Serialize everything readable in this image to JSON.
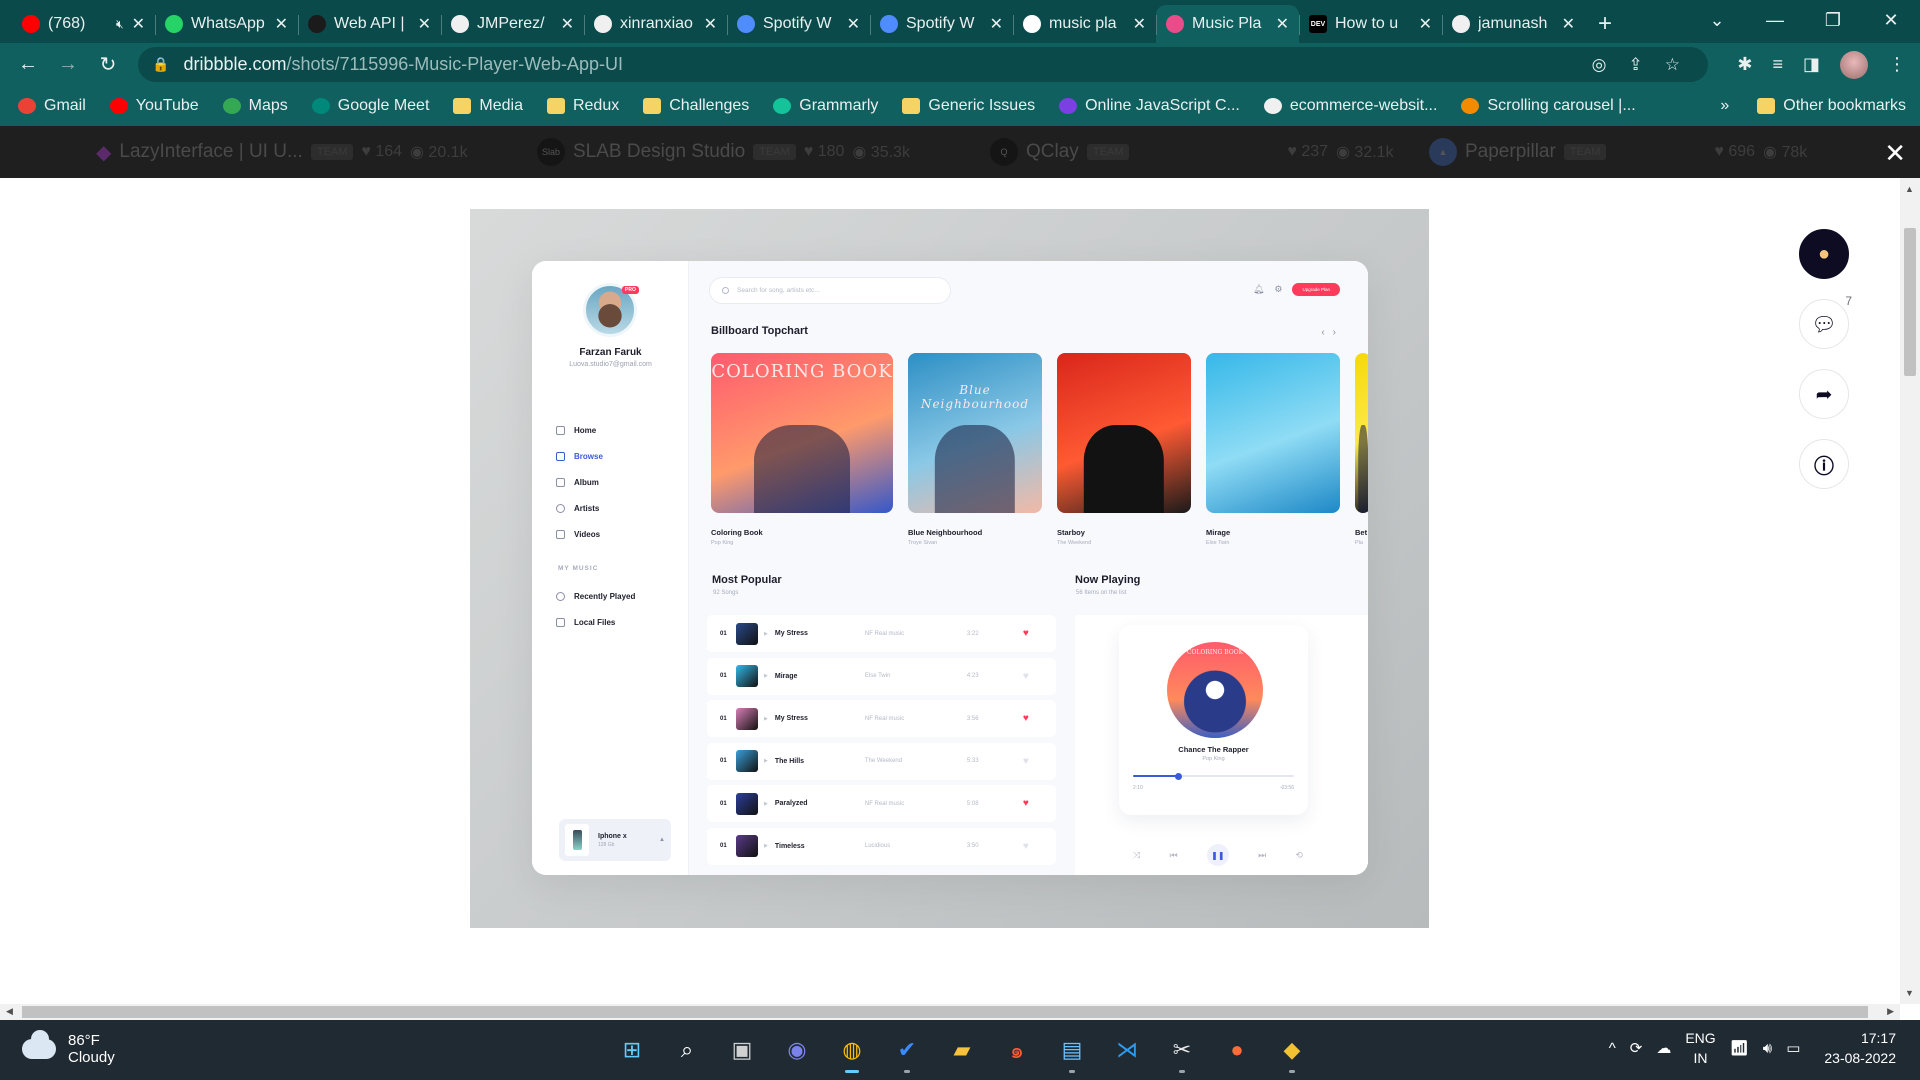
{
  "browser": {
    "tabs": [
      {
        "title": "(768)",
        "icon": "youtube-icon",
        "color": "#ff0000",
        "muted": true
      },
      {
        "title": "WhatsApp",
        "icon": "whatsapp-icon",
        "color": "#25d366"
      },
      {
        "title": "Web API |",
        "icon": "spotify-icon",
        "color": "#1b1b1b"
      },
      {
        "title": "JMPerez/",
        "icon": "github-icon",
        "color": "#f0f0f0"
      },
      {
        "title": "xinranxiao",
        "icon": "github-icon",
        "color": "#f0f0f0"
      },
      {
        "title": "Spotify W",
        "icon": "cloud-icon",
        "color": "#4f8cff"
      },
      {
        "title": "Spotify W",
        "icon": "cloud-icon",
        "color": "#4f8cff"
      },
      {
        "title": "music pla",
        "icon": "google-icon",
        "color": "#ffffff"
      },
      {
        "title": "Music Pla",
        "icon": "dribbble-icon",
        "color": "#ea4c89",
        "active": true
      },
      {
        "title": "How to u",
        "icon": "dev-icon",
        "color": "#000000"
      },
      {
        "title": "jamunash",
        "icon": "github-icon",
        "color": "#f0f0f0"
      }
    ],
    "url_host": "dribbble.com",
    "url_path": "/shots/7115996-Music-Player-Web-App-UI",
    "bookmarks": [
      {
        "label": "Gmail",
        "icon": "gmail-icon",
        "color": "#ea4335"
      },
      {
        "label": "YouTube",
        "icon": "youtube-icon",
        "color": "#ff0000"
      },
      {
        "label": "Maps",
        "icon": "maps-icon",
        "color": "#34a853"
      },
      {
        "label": "Google Meet",
        "icon": "meet-icon",
        "color": "#00897b"
      },
      {
        "label": "Media",
        "icon": "folder-icon",
        "color": "#f6d365"
      },
      {
        "label": "Redux",
        "icon": "folder-icon",
        "color": "#f6d365"
      },
      {
        "label": "Challenges",
        "icon": "folder-icon",
        "color": "#f6d365"
      },
      {
        "label": "Grammarly",
        "icon": "grammarly-icon",
        "color": "#15c39a"
      },
      {
        "label": "Generic Issues",
        "icon": "folder-icon",
        "color": "#f6d365"
      },
      {
        "label": "Online JavaScript C...",
        "icon": "js-icon",
        "color": "#7b3fe4"
      },
      {
        "label": "ecommerce-websit...",
        "icon": "github-icon",
        "color": "#f0f0f0"
      },
      {
        "label": "Scrolling carousel |...",
        "icon": "bookmark-icon",
        "color": "#f28b00"
      }
    ],
    "more_label": "»",
    "other_bookmarks": "Other bookmarks"
  },
  "dribbble": {
    "strip": [
      {
        "name": "LazyInterface | UI U...",
        "team": "TEAM",
        "likes": "164",
        "views": "20.1k"
      },
      {
        "name": "SLAB Design Studio",
        "team": "TEAM",
        "likes": "180",
        "views": "35.3k"
      },
      {
        "name": "QClay",
        "team": "TEAM",
        "likes": "237",
        "views": "32.1k"
      },
      {
        "name": "Paperpillar",
        "team": "TEAM",
        "likes": "696",
        "views": "78k"
      }
    ],
    "comments_count": "7"
  },
  "app": {
    "user_name": "Farzan Faruk",
    "user_email": "Luova.studio7@gmail.com",
    "pro_badge": "PRO",
    "nav": [
      "Home",
      "Browse",
      "Album",
      "Artists",
      "Videos"
    ],
    "my_music_title": "MY MUSIC",
    "my_music": [
      "Recently Played",
      "Local Files"
    ],
    "device_name": "Iphone x",
    "device_sub": "128 Gb",
    "search_placeholder": "Search for song, artists etc...",
    "upgrade_label": "Upgrade Plan",
    "billboard_title": "Billboard Topchart",
    "albums": [
      {
        "title": "Coloring Book",
        "artist": "Pop King",
        "cover_text": "COLORING BOOK",
        "colors": [
          "#ff5a6e",
          "#ff9a6b",
          "#3558c9"
        ]
      },
      {
        "title": "Blue Neighbourhood",
        "artist": "Troye Sivan",
        "cover_text": "Blue Neighbourhood",
        "colors": [
          "#2d8fc4",
          "#8ac8e6",
          "#f2b9a6"
        ]
      },
      {
        "title": "Starboy",
        "artist": "The Weekend",
        "cover_text": "",
        "colors": [
          "#d9261c",
          "#ff5a33",
          "#1a1a1a"
        ]
      },
      {
        "title": "Mirage",
        "artist": "Else Twin",
        "cover_text": "",
        "colors": [
          "#35b8e8",
          "#8fdcf5",
          "#1d88c6"
        ]
      },
      {
        "title": "Bet",
        "artist": "Pla",
        "cover_text": "",
        "colors": [
          "#f5d90a",
          "#ffe94a",
          "#222222"
        ]
      }
    ],
    "popular_title": "Most Popular",
    "popular_sub": "92 Songs",
    "tracks": [
      {
        "num": "01",
        "name": "My Stress",
        "artist": "NF Real music",
        "duration": "3:22",
        "liked": true,
        "color": "#2a4a8a"
      },
      {
        "num": "01",
        "name": "Mirage",
        "artist": "Else Twin",
        "duration": "4:23",
        "liked": false,
        "color": "#35b8e8"
      },
      {
        "num": "01",
        "name": "My Stress",
        "artist": "NF Real music",
        "duration": "3:56",
        "liked": true,
        "color": "#d97fb6"
      },
      {
        "num": "01",
        "name": "The Hills",
        "artist": "The Weekend",
        "duration": "5:33",
        "liked": false,
        "color": "#3aa0d8"
      },
      {
        "num": "01",
        "name": "Paralyzed",
        "artist": "NF Real music",
        "duration": "5:08",
        "liked": true,
        "color": "#2c3f9a"
      },
      {
        "num": "01",
        "name": "Timeless",
        "artist": "Lucidious",
        "duration": "3:50",
        "liked": false,
        "color": "#5a3a8a"
      }
    ],
    "now_title": "Now Playing",
    "now_sub": "56 Items on the list",
    "now_song": "Chance The Rapper",
    "now_artist": "Pop King",
    "now_disc_text": "COLORING BOOK",
    "now_progress": 0.28,
    "time_current": "2:10",
    "time_total": "-03:56",
    "accent": "#3a5bd9",
    "heart_color": "#ff3b5c"
  },
  "taskbar": {
    "temperature": "86°F",
    "condition": "Cloudy",
    "lang_1": "ENG",
    "lang_2": "IN",
    "time": "17:17",
    "date": "23-08-2022",
    "apps": [
      "start-icon",
      "search-icon",
      "task-view-icon",
      "teams-icon",
      "chrome-icon",
      "todo-icon",
      "file-explorer-icon",
      "snail-icon",
      "notepad-icon",
      "vscode-icon",
      "snipping-icon",
      "postman-icon",
      "git-icon"
    ]
  }
}
